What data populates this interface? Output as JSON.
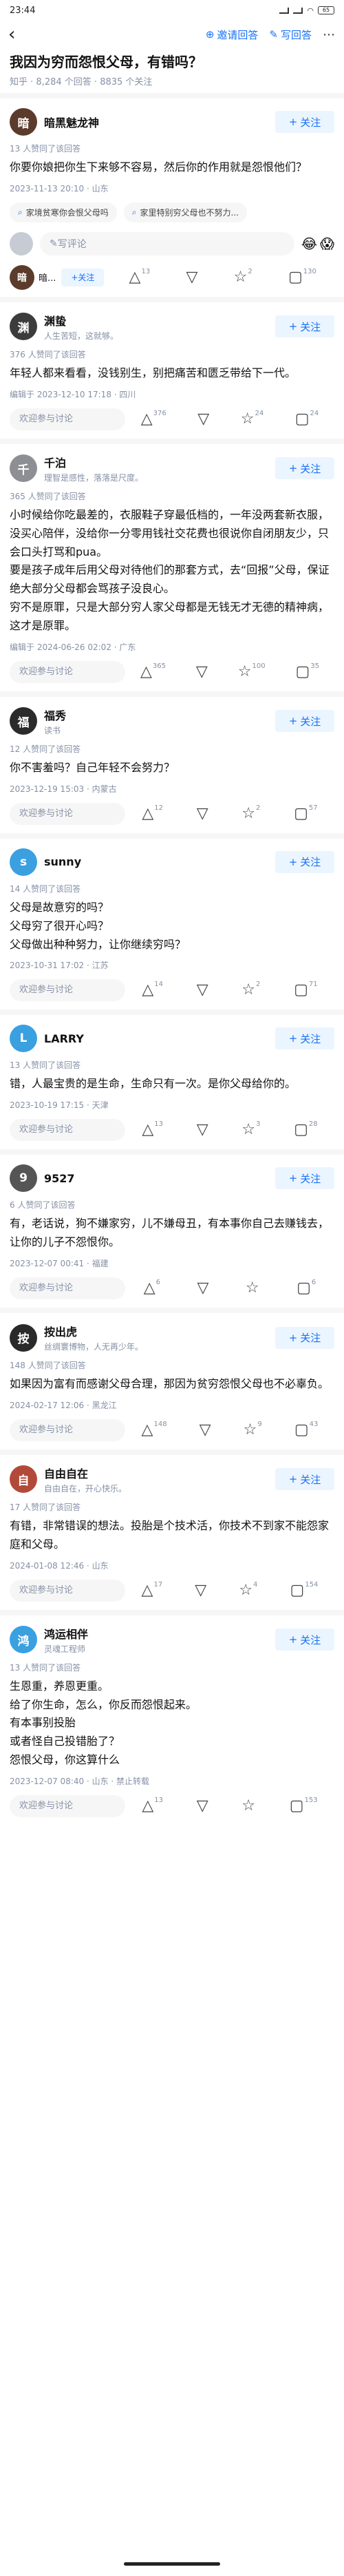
{
  "status": {
    "time": "23:44",
    "battery": "65"
  },
  "nav": {
    "invite": "邀请回答",
    "write": "写回答"
  },
  "question": {
    "title": "我因为穷而怨恨父母，有错吗？",
    "source": "知乎",
    "answers": "8,284 个回答",
    "follows": "8835 个关注"
  },
  "comment_placeholder": "欢迎参与讨论",
  "follow_label": "关注",
  "answers": [
    {
      "author": "暗黑魅龙神",
      "bio": "",
      "avatar_text": "暗",
      "avatar_color": "#5a3b2c",
      "approve": "13 人赞同了该回答",
      "body": [
        "你要你娘把你生下来够不容易，然后你的作用就是怨恨他们？"
      ],
      "time": "2023-11-13 20:10 · 山东",
      "tags": [
        "家境贫寒你会恨父母吗",
        "家里特别穷父母也不努力..."
      ],
      "comment_input": "写评论",
      "emojis": [
        "😂",
        "😱"
      ],
      "short_name": "暗...",
      "counts": {
        "like": "13",
        "star": "2",
        "comment": "130"
      }
    },
    {
      "author": "渊蛰",
      "bio": "人生苦短，这就够。",
      "avatar_text": "渊",
      "avatar_color": "#3c3c3c",
      "approve": "376 人赞同了该回答",
      "body": [
        "年轻人都来看看，没钱别生，别把痛苦和匮乏带给下一代。"
      ],
      "time": "编辑于 2023-12-10 17:18 · 四川",
      "counts": {
        "like": "376",
        "star": "24",
        "comment": "24"
      }
    },
    {
      "author": "千泊",
      "bio": "理智是感性，落落是尺度。",
      "avatar_text": "千",
      "avatar_color": "#8d8f94",
      "approve": "365 人赞同了该回答",
      "body": [
        "小时候给你吃最差的，衣服鞋子穿最低档的，一年没两套新衣服，没买心陪伴，没给你一分零用钱社交花费也很说你自闭朋友少，只会口头打骂和pua。",
        "要是孩子成年后用父母对待他们的那套方式，去“回报”父母，保证绝大部分父母都会骂孩子没良心。",
        "穷不是原罪，只是大部分穷人家父母都是无钱无才无德的精神病，这才是原罪。"
      ],
      "time": "编辑于 2024-06-26 02:02 · 广东",
      "counts": {
        "like": "365",
        "star": "100",
        "comment": "35"
      }
    },
    {
      "author": "福秀",
      "bio": "读书",
      "avatar_text": "福",
      "avatar_color": "#2b2b2b",
      "approve": "12 人赞同了该回答",
      "body": [
        "你不害羞吗？自己年轻不会努力？"
      ],
      "time": "2023-12-19 15:03 · 内蒙古",
      "counts": {
        "like": "12",
        "star": "2",
        "comment": "57"
      }
    },
    {
      "author": "sunny",
      "bio": "",
      "avatar_text": "s",
      "avatar_color": "#3aa0e0",
      "approve": "14 人赞同了该回答",
      "body": [
        "父母是故意穷的吗？",
        "父母穷了很开心吗？",
        "父母做出种种努力，让你继续穷吗？"
      ],
      "time": "2023-10-31 17:02 · 江苏",
      "counts": {
        "like": "14",
        "star": "2",
        "comment": "71"
      }
    },
    {
      "author": "LARRY",
      "bio": "",
      "avatar_text": "L",
      "avatar_color": "#3aa0e0",
      "approve": "13 人赞同了该回答",
      "body": [
        "错，人最宝贵的是生命，生命只有一次。是你父母给你的。"
      ],
      "time": "2023-10-19 17:15 · 天津",
      "counts": {
        "like": "13",
        "star": "3",
        "comment": "28"
      }
    },
    {
      "author": "9527",
      "bio": "",
      "avatar_text": "9",
      "avatar_color": "#555555",
      "approve": "6 人赞同了该回答",
      "body": [
        "有，老话说，狗不嫌家穷，儿不嫌母丑，有本事你自己去赚钱去，让你的儿子不怨恨你。"
      ],
      "time": "2023-12-07 00:41 · 福建",
      "counts": {
        "like": "6",
        "star": "",
        "comment": "6"
      }
    },
    {
      "author": "按出虎",
      "bio": "丝绸寰博物，人无再少年。",
      "avatar_text": "按",
      "avatar_color": "#2a2a2a",
      "approve": "148 人赞同了该回答",
      "body": [
        "如果因为富有而感谢父母合理，那因为贫穷怨恨父母也不必辜负。"
      ],
      "time": "2024-02-17 12:06 · 黑龙江",
      "counts": {
        "like": "148",
        "star": "9",
        "comment": "43"
      }
    },
    {
      "author": "自由自在",
      "bio": "自由自在，开心快乐。",
      "avatar_text": "自",
      "avatar_color": "#b24a3a",
      "approve": "17 人赞同了该回答",
      "body": [
        "有错，非常错误的想法。投胎是个技术活，你技术不到家不能怨家庭和父母。"
      ],
      "time": "2024-01-08 12:46 · 山东",
      "counts": {
        "like": "17",
        "star": "4",
        "comment": "154"
      }
    },
    {
      "author": "鸿运相伴",
      "bio": "灵魂工程师",
      "avatar_text": "鸿",
      "avatar_color": "#3aa0e0",
      "approve": "13 人赞同了该回答",
      "body": [
        "生恩重，养恩更重。",
        "给了你生命，怎么，你反而怨恨起来。",
        "有本事别投胎",
        "或者怪自己投错胎了？",
        "怨恨父母，你这算什么"
      ],
      "time": "2023-12-07 08:40 · 山东 · 禁止转载",
      "counts": {
        "like": "13",
        "star": "",
        "comment": "153"
      }
    }
  ]
}
